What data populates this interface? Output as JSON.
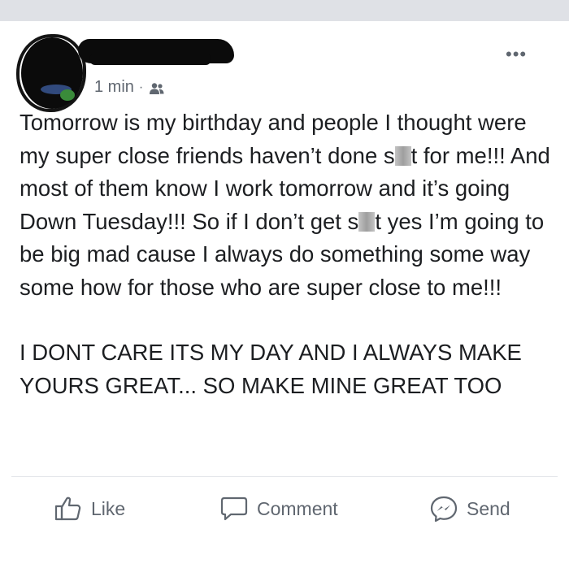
{
  "post": {
    "timestamp": "1 min",
    "separator": "·",
    "audience_icon": "friends-icon",
    "more_icon": "•••",
    "body": {
      "p1_a": "Tomorrow is my birthday and people I thought were my super close friends haven’t done s",
      "p1_b": "t for me!!! And most of them know I work tomorrow and it’s going Down Tuesday!!! So if I don’t get s",
      "p1_c": "t yes I’m going to be big mad cause I always do something some way some how for those who are super close to me!!!",
      "p2": "I DONT CARE ITS MY DAY AND I ALWAYS MAKE YOURS GREAT... SO MAKE MINE GREAT TOO"
    }
  },
  "actions": {
    "like_label": "Like",
    "comment_label": "Comment",
    "send_label": "Send"
  },
  "colors": {
    "text": "#1c1e21",
    "secondary": "#606770",
    "background": "#ffffff",
    "top_strip": "#dfe1e6"
  }
}
